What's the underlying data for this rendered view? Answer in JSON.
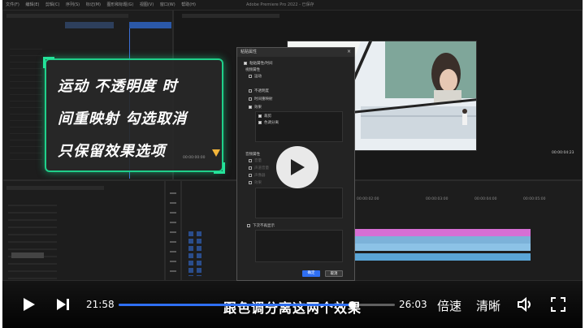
{
  "editor": {
    "menu": [
      "文件(F)",
      "编辑(E)",
      "剪辑(C)",
      "序列(S)",
      "标记(M)",
      "图形和标题(G)",
      "视图(V)",
      "窗口(W)",
      "帮助(H)"
    ],
    "window_title": "Adobe Premiere Pro 2022 - 已保存"
  },
  "overlay": {
    "lines": [
      "运动 不透明度 时",
      "间重映射 勾选取消",
      "只保留效果选项"
    ],
    "timecode": "00:00:00:00"
  },
  "dialog": {
    "title": "粘贴属性",
    "paste_attr": "粘贴属性/时间",
    "video_section": "视频属性",
    "items": [
      "运动",
      "不透明度",
      "时间重映射",
      "效果"
    ],
    "sub_items": [
      "裁剪",
      "色调分离"
    ],
    "audio_section": "音频属性",
    "audio_items": [
      "音量",
      "声道音量",
      "声像器"
    ],
    "audio_effects": "效果",
    "no_show": "下次不再显示",
    "ok": "确定",
    "cancel": "取消"
  },
  "preview": {
    "timecode": "00:00:04:23"
  },
  "timeline": {
    "ruler": [
      "00:00:02:00",
      "00:00:03:00",
      "00:00:04:00",
      "00:00:05:00"
    ],
    "tracks": [
      "V3",
      "V2",
      "V1",
      "A1",
      "A2",
      "A3"
    ]
  },
  "player": {
    "subtitle": "跟色调分离这两个效果",
    "current_time": "21:58",
    "total_time": "26:03",
    "progress": 0.843,
    "speed_label": "倍速",
    "quality_label": "清晰",
    "accent": "#2f6ff3"
  }
}
